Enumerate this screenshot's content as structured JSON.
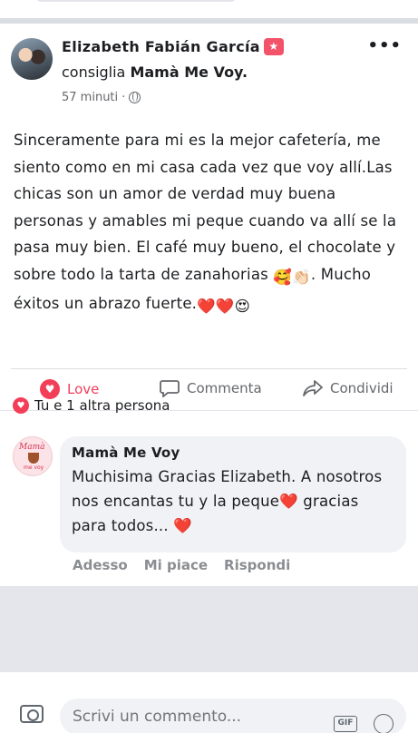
{
  "post": {
    "author": "Elizabeth Fabián García",
    "badge_icon": "star-badge-icon",
    "action_verb": "consiglia",
    "page_name": "Mamà Me Voy",
    "page_name_suffix": ".",
    "time": "57 minuti",
    "separator": "·",
    "privacy_icon": "globe-icon",
    "text_part1": "Sinceramente para mi es la mejor cafetería, me siento como en mi casa cada vez que voy allí.Las chicas son un amor de verdad muy buena personas y amables mi peque cuando va allí se la pasa muy bien. El café muy bueno, el chocolate y sobre todo la tarta de zanahorias",
    "emoji_1": "🥰👏🏻",
    "text_part2": ". Mucho éxitos un abrazo fuerte.",
    "emoji_2": "❤️❤️😍"
  },
  "actions": {
    "love_label": "Love",
    "comment_label": "Commenta",
    "share_label": "Condividi"
  },
  "reactions": {
    "summary": "Tu e 1 altra persona"
  },
  "comment": {
    "author": "Mamà Me Voy",
    "text_part1": "Muchisima Gracias Elizabeth. A nosotros nos encantas tu y la peque",
    "emoji_1": "❤️",
    "text_part2": " gracias para todos...",
    "emoji_2": "❤️",
    "avatar_text_top": "Mamà",
    "avatar_text_bottom": "me voy",
    "reply_actions": [
      "Adesso",
      "Mi piace",
      "Rispondi"
    ]
  },
  "composer": {
    "placeholder": "Scrivi un commento...",
    "gif_label": "GIF"
  },
  "colors": {
    "love_red": "#f33e58",
    "secondary_text": "#65676b",
    "bubble_bg": "#f0f2f5"
  }
}
